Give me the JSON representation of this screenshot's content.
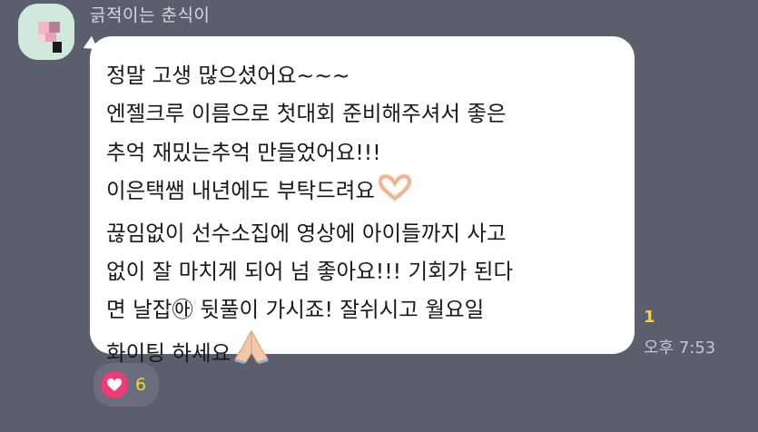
{
  "sender": {
    "name": "긁적이는 춘식이"
  },
  "message": {
    "lines": [
      "정말 고생 많으셨어요~~~",
      "엔젤크루 이름으로 첫대회 준비해주셔서 좋은",
      "추억 재밌는추억 만들었어요!!!",
      "이은택쌤 내년에도 부탁드려요",
      "끊임없이 선수소집에 영상에 아이들까지 사고",
      "없이 잘 마치게 되어 넘 좋아요!!! 기회가 된다",
      "면 날잡㉵  뒷풀이 가시죠! 잘쉬시고 월요일",
      "화이팅 하세요"
    ],
    "inline_emojis": {
      "line_4": "heart-hands-emoji",
      "line_8": "folded-hands-emoji"
    }
  },
  "meta": {
    "unread_count": "1",
    "time": "오후 7:53"
  },
  "reaction": {
    "icon": "heart-icon",
    "count": "6",
    "color": "#ef3c74"
  }
}
